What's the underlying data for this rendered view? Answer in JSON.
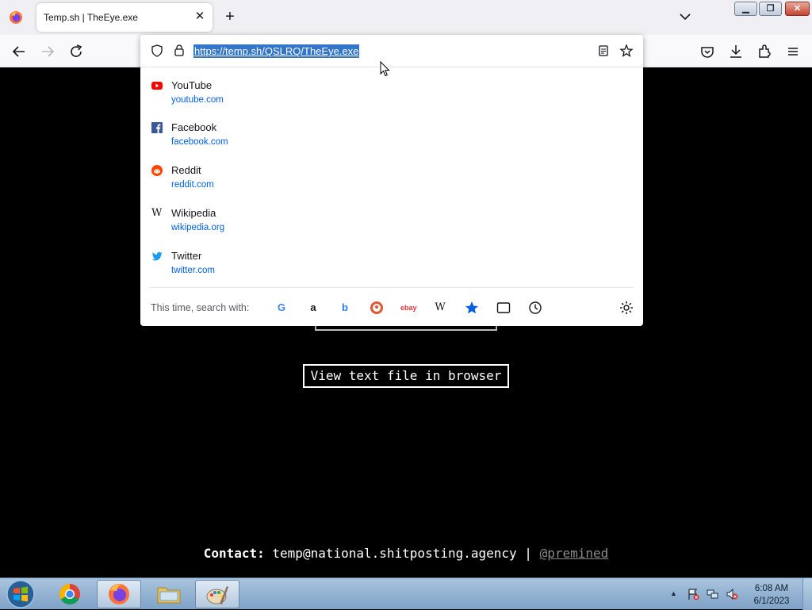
{
  "browser": {
    "tab": {
      "title": "Temp.sh | TheEye.exe",
      "close_glyph": "✕"
    },
    "newtab_glyph": "+",
    "caption": {
      "minimize": "▁",
      "maximize": "❐",
      "close": "✕"
    },
    "url": "https://temp.sh/QSLRQ/TheEye.exe"
  },
  "urlbar_dropdown": {
    "suggestions": [
      {
        "title": "YouTube",
        "url": "youtube.com",
        "icon": "youtube-icon"
      },
      {
        "title": "Facebook",
        "url": "facebook.com",
        "icon": "facebook-icon"
      },
      {
        "title": "Reddit",
        "url": "reddit.com",
        "icon": "reddit-icon"
      },
      {
        "title": "Wikipedia",
        "url": "wikipedia.org",
        "icon": "wikipedia-icon"
      },
      {
        "title": "Twitter",
        "url": "twitter.com",
        "icon": "twitter-icon"
      }
    ],
    "search_with_label": "This time, search with:",
    "engines": [
      "google-icon",
      "amazon-icon",
      "bing-icon",
      "duckduckgo-icon",
      "ebay-icon",
      "wikipedia-icon",
      "bookmarks-icon",
      "tabs-icon",
      "history-icon"
    ]
  },
  "page": {
    "view_button": "View text file in browser",
    "contact_label": "Contact:",
    "contact_email": "temp@national.shitposting.agency",
    "contact_separator": "|",
    "contact_handle": "@premined"
  },
  "taskbar": {
    "clock_time": "6:08 AM",
    "clock_date": "6/1/2023"
  },
  "colors": {
    "accent": "#3375c8",
    "link": "#0060df",
    "page_bg": "#000000"
  }
}
